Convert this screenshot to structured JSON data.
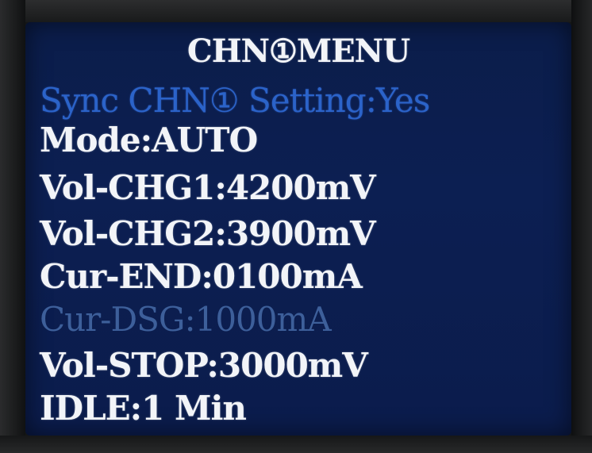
{
  "title": "CHN①MENU",
  "sync": "Sync CHN① Setting:Yes",
  "items": [
    "Mode:AUTO",
    "Vol-CHG1:4200mV",
    "Vol-CHG2:3900mV",
    "Cur-END:0100mA",
    "Cur-DSG:1000mA",
    "Vol-STOP:3000mV",
    "IDLE:1 Min"
  ],
  "colors": {
    "screen_bg": "#0c1f52",
    "text": "#f2f4f8",
    "highlight": "#2b63c9",
    "dim": "#3d5f9a"
  }
}
